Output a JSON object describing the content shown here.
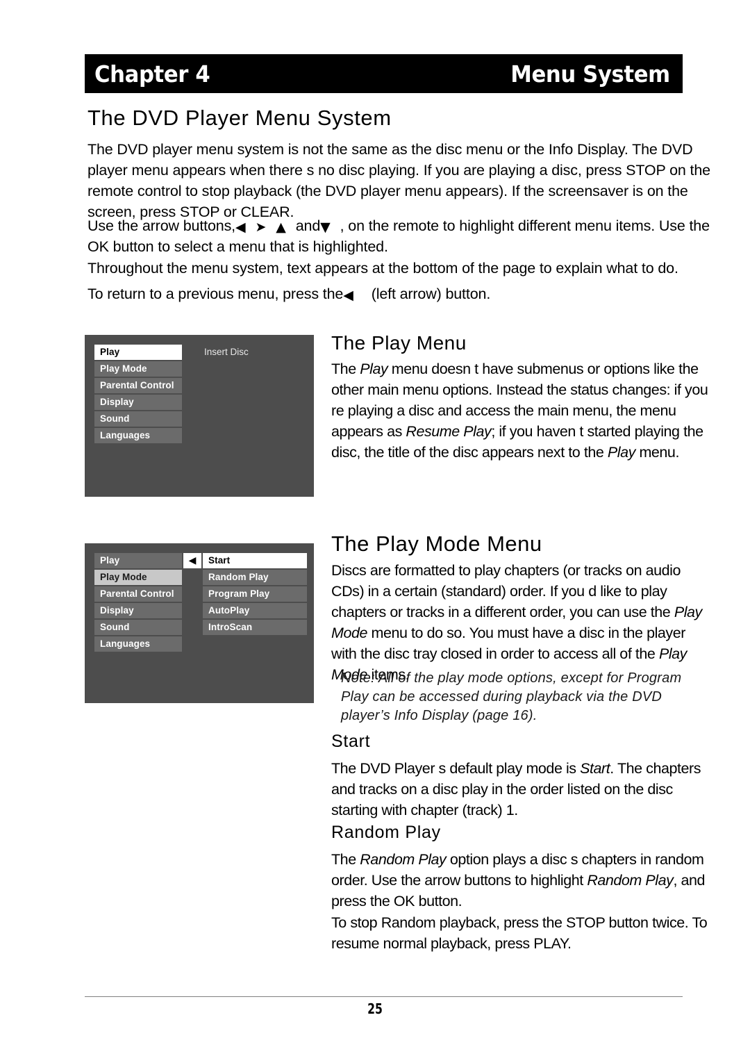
{
  "header": {
    "chapter_label": "Chapter 4",
    "chapter_title": "Menu System"
  },
  "page_title": "The DVD Player Menu System",
  "intro": {
    "p1": "The DVD player menu system is not the same as the disc menu or the Info Display. The DVD player menu appears when there s no disc playing. If you are playing a disc, press STOP on the remote control to stop playback (the DVD player menu appears). If the screensaver is on the screen, press STOP or CLEAR.",
    "p2_a": "Use the arrow buttons,",
    "p2_arrow_left": "◀",
    "p2_arrow_right": "➤",
    "p2_arrow_up": "▲",
    "p2_and": "and",
    "p2_arrow_down": "▼",
    "p2_b": ", on the remote to highlight different menu items. Use the OK button to select a menu that is highlighted.",
    "p3": "Throughout the menu system, text appears at the bottom of the page to explain what to do.",
    "p4_a": "To return to a previous menu, press the",
    "p4_arrow": "◀",
    "p4_b": "(left arrow) button."
  },
  "menu_screenshot_1": {
    "items": [
      {
        "label": "Play",
        "state": "selected-white"
      },
      {
        "label": "Play Mode",
        "state": "normal"
      },
      {
        "label": "Parental Control",
        "state": "normal"
      },
      {
        "label": "Display",
        "state": "normal"
      },
      {
        "label": "Sound",
        "state": "normal"
      },
      {
        "label": "Languages",
        "state": "normal"
      }
    ],
    "status_text": "Insert Disc",
    "colors": {
      "panel_bg": "#4d4d4d",
      "item_bg": "#6b6b6b",
      "item_text": "#ffffff",
      "selected_bg": "#ffffff",
      "selected_text": "#000000"
    }
  },
  "menu_screenshot_2": {
    "main_items": [
      {
        "label": "Play",
        "state": "normal"
      },
      {
        "label": "Play Mode",
        "state": "selected-gray"
      },
      {
        "label": "Parental Control",
        "state": "normal"
      },
      {
        "label": "Display",
        "state": "normal"
      },
      {
        "label": "Sound",
        "state": "normal"
      },
      {
        "label": "Languages",
        "state": "normal"
      }
    ],
    "back_arrow": "◀",
    "sub_items": [
      {
        "label": "Start",
        "state": "selected-white"
      },
      {
        "label": "Random Play",
        "state": "normal"
      },
      {
        "label": "Program Play",
        "state": "normal"
      },
      {
        "label": "AutoPlay",
        "state": "normal"
      },
      {
        "label": "IntroScan",
        "state": "normal"
      }
    ],
    "colors": {
      "panel_bg": "#4d4d4d",
      "item_bg": "#6b6b6b",
      "selected_gray_bg": "#c8c8c8",
      "selected_white_bg": "#ffffff"
    }
  },
  "section_play_menu": {
    "heading": "The Play Menu",
    "body_1": "The ",
    "body_i1": "Play",
    "body_2": " menu doesn t have submenus or options like the other main menu options. Instead the status changes: if you re playing a disc and access the main menu, the menu appears as ",
    "body_i2": "Resume Play",
    "body_3": "; if you haven t started playing the disc, the title of the disc appears next to the ",
    "body_i3": "Play",
    "body_4": " menu."
  },
  "section_play_mode": {
    "heading": "The Play Mode Menu",
    "body_1": "Discs are formatted to play chapters (or tracks on audio CDs) in a certain (standard) order. If you d like to play chapters or tracks in a different order, you can use the ",
    "body_i1": "Play Mode",
    "body_2": " menu to do so. You must have a disc in the player with the disc tray closed in order to access all of the ",
    "body_i2": "Play Mode",
    "body_3": " items.",
    "note": "Note: All of the play mode options, except for Program Play can be accessed during playback via the DVD player’s Info Display (page 16)."
  },
  "section_start": {
    "heading": "Start",
    "body_1": "The DVD Player s default play mode is ",
    "body_i1": "Start",
    "body_2": ". The chapters and tracks on a disc play in the order listed on the disc starting with chapter (track) 1."
  },
  "section_random_play": {
    "heading": "Random Play",
    "body_1": "The ",
    "body_i1": "Random Play",
    "body_2": " option plays a disc s chapters in random order. Use the arrow buttons to highlight ",
    "body_i2": "Random Play",
    "body_3": ", and press the OK button.",
    "body_4": "To stop Random playback, press the STOP button twice. To resume normal playback, press PLAY."
  },
  "footer": {
    "page_number": "25"
  }
}
